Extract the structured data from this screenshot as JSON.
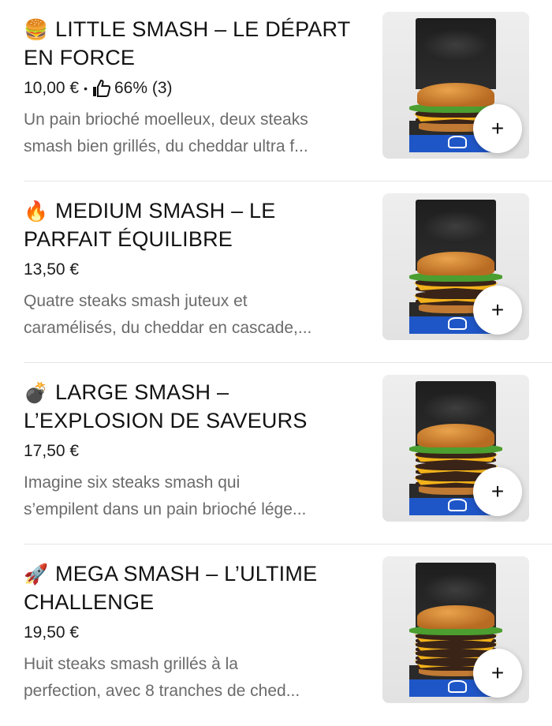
{
  "menu": {
    "items": [
      {
        "emoji": "🍔",
        "title_line1": "LITTLE SMASH – LE DÉPART",
        "title_line2": "EN FORCE",
        "price": "10,00 €",
        "rating_separator": "•",
        "rating_icon": "thumbs-up-icon",
        "rating": "66% (3)",
        "desc_line1": "Un pain brioché moelleux, deux steaks",
        "desc_line2": "smash bien grillés, du cheddar ultra f...",
        "add_label": "+",
        "patties": 2
      },
      {
        "emoji": "🔥",
        "title_line1": "MEDIUM SMASH – LE",
        "title_line2": "PARFAIT ÉQUILIBRE",
        "price": "13,50 €",
        "desc_line1": "Quatre steaks smash juteux et",
        "desc_line2": "caramélisés, du cheddar en cascade,...",
        "add_label": "+",
        "patties": 4
      },
      {
        "emoji": "💣",
        "title_line1": "LARGE SMASH –",
        "title_line2": "L’EXPLOSION DE SAVEURS",
        "price": "17,50 €",
        "desc_line1": "Imagine six steaks smash qui",
        "desc_line2": "s’empilent dans un pain brioché lége...",
        "add_label": "+",
        "patties": 6
      },
      {
        "emoji": "🚀",
        "title_line1": "MEGA SMASH – L’ULTIME",
        "title_line2": "CHALLENGE",
        "price": "19,50 €",
        "desc_line1": "Huit steaks smash grillés à la",
        "desc_line2": "perfection, avec 8 tranches de ched...",
        "add_label": "+",
        "patties": 8
      }
    ]
  },
  "colors": {
    "box_stripe": "#1f56c7",
    "text_primary": "#121212",
    "text_secondary": "#6b6b6b"
  }
}
